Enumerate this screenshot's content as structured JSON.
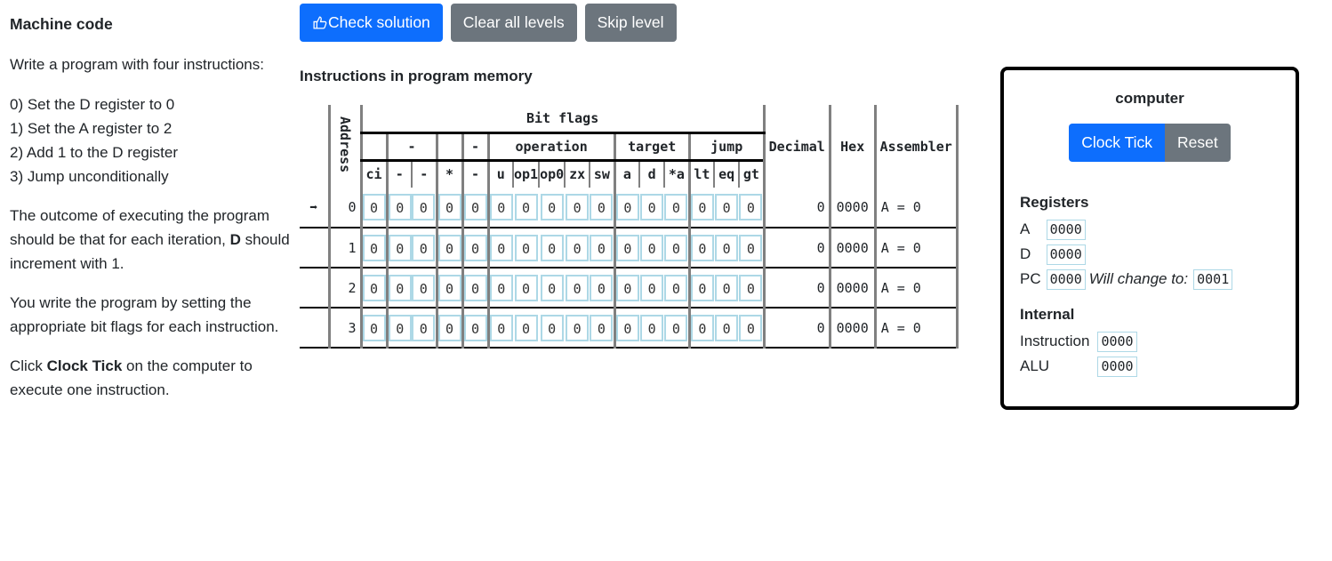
{
  "left": {
    "title": "Machine code",
    "intro": "Write a program with four instructions:",
    "steps": [
      "0) Set the D register to 0",
      "1) Set the A register to 2",
      "2) Add 1 to the D register",
      "3) Jump unconditionally"
    ],
    "outcome_prefix": "The outcome of executing the program should be that for each iteration, ",
    "outcome_bold": "D",
    "outcome_suffix": " should increment with 1.",
    "howto": "You write the program by setting the appropriate bit flags for each instruction.",
    "click_prefix": "Click ",
    "click_bold": "Clock Tick",
    "click_suffix": " on the computer to execute one instruction."
  },
  "toolbar": {
    "check_label": "Check solution",
    "check_icon": "thumbs-up-icon",
    "clear_label": "Clear all levels",
    "skip_label": "Skip level"
  },
  "program": {
    "title": "Instructions in program memory",
    "address_header": "Address",
    "bitflags_header": "Bit flags",
    "decimal_header": "Decimal",
    "hex_header": "Hex",
    "assembler_header": "Assembler",
    "groups": [
      "",
      "-",
      "",
      "-",
      "operation",
      "target",
      "jump"
    ],
    "bit_labels": [
      "ci",
      "-",
      "-",
      "*",
      "-",
      "u",
      "op1",
      "op0",
      "zx",
      "sw",
      "a",
      "d",
      "*a",
      "lt",
      "eq",
      "gt"
    ],
    "current_marker": "➡",
    "rows": [
      {
        "address": "0",
        "bits": [
          "0",
          "0",
          "0",
          "0",
          "0",
          "0",
          "0",
          "0",
          "0",
          "0",
          "0",
          "0",
          "0",
          "0",
          "0",
          "0"
        ],
        "decimal": "0",
        "hex": "0000",
        "assembler": "A = 0",
        "current": true
      },
      {
        "address": "1",
        "bits": [
          "0",
          "0",
          "0",
          "0",
          "0",
          "0",
          "0",
          "0",
          "0",
          "0",
          "0",
          "0",
          "0",
          "0",
          "0",
          "0"
        ],
        "decimal": "0",
        "hex": "0000",
        "assembler": "A = 0",
        "current": false
      },
      {
        "address": "2",
        "bits": [
          "0",
          "0",
          "0",
          "0",
          "0",
          "0",
          "0",
          "0",
          "0",
          "0",
          "0",
          "0",
          "0",
          "0",
          "0",
          "0"
        ],
        "decimal": "0",
        "hex": "0000",
        "assembler": "A = 0",
        "current": false
      },
      {
        "address": "3",
        "bits": [
          "0",
          "0",
          "0",
          "0",
          "0",
          "0",
          "0",
          "0",
          "0",
          "0",
          "0",
          "0",
          "0",
          "0",
          "0",
          "0"
        ],
        "decimal": "0",
        "hex": "0000",
        "assembler": "A = 0",
        "current": false
      }
    ]
  },
  "computer": {
    "title": "computer",
    "clock_tick_label": "Clock Tick",
    "reset_label": "Reset",
    "registers_title": "Registers",
    "registers": {
      "a_label": "A",
      "a_value": "0000",
      "d_label": "D",
      "d_value": "0000",
      "pc_label": "PC",
      "pc_value": "0000",
      "will_change_label": "Will change to:",
      "pc_next": "0001"
    },
    "internal_title": "Internal",
    "internal": {
      "instruction_label": "Instruction",
      "instruction_value": "0000",
      "alu_label": "ALU",
      "alu_value": "0000"
    }
  }
}
